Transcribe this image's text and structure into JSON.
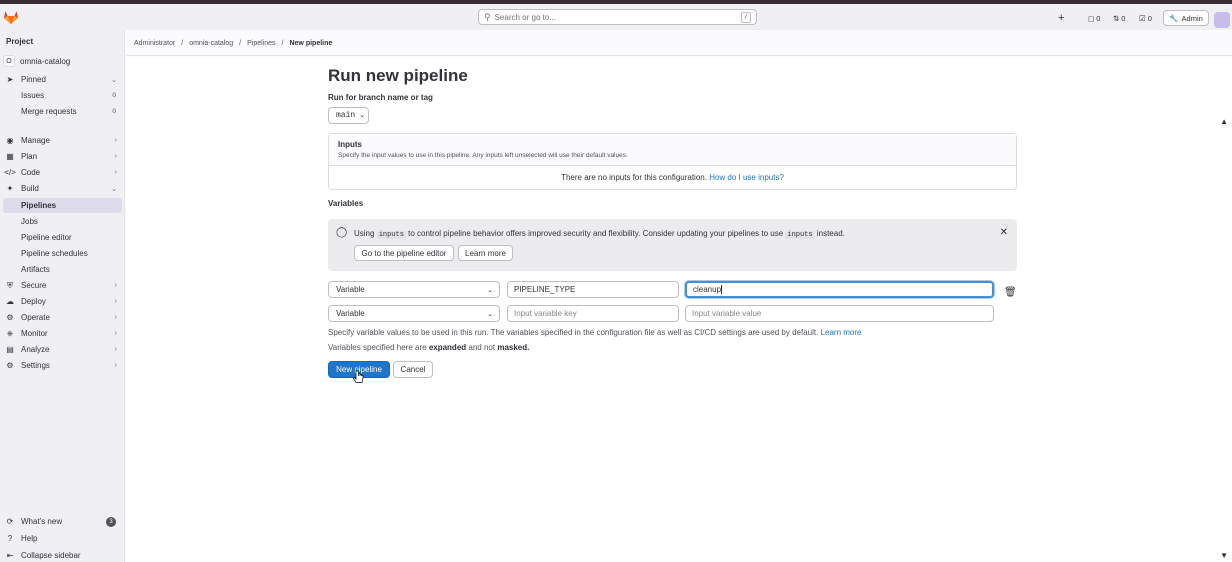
{
  "topbar": {
    "search_placeholder": "Search or go to...",
    "search_shortcut": "/",
    "issues_count": "0",
    "mr_count": "0",
    "todo_count": "0",
    "admin_label": "Admin"
  },
  "sidebar": {
    "heading": "Project",
    "project_initial": "O",
    "project_name": "omnia-catalog",
    "pinned": "Pinned",
    "issues": "Issues",
    "issues_count": "0",
    "merge_requests": "Merge requests",
    "mr_count": "0",
    "manage": "Manage",
    "plan": "Plan",
    "code": "Code",
    "build": "Build",
    "pipelines": "Pipelines",
    "jobs": "Jobs",
    "pipeline_editor": "Pipeline editor",
    "pipeline_schedules": "Pipeline schedules",
    "artifacts": "Artifacts",
    "secure": "Secure",
    "deploy": "Deploy",
    "operate": "Operate",
    "monitor": "Monitor",
    "analyze": "Analyze",
    "settings": "Settings",
    "whats_new": "What's new",
    "whats_new_count": "3",
    "help": "Help",
    "collapse": "Collapse sidebar"
  },
  "breadcrumb": [
    "Administrator",
    "omnia-catalog",
    "Pipelines",
    "New pipeline"
  ],
  "breadcrumb_sep": "/",
  "page": {
    "title": "Run new pipeline",
    "branch_label": "Run for branch name or tag",
    "branch_value": "main",
    "inputs_title": "Inputs",
    "inputs_desc": "Specify the input values to use in this pipeline. Any inputs left unselected will use their default values.",
    "inputs_empty": "There are no inputs for this configuration.",
    "inputs_link": "How do I use inputs?",
    "variables_heading": "Variables",
    "alert_part1": "Using",
    "alert_code1": "inputs",
    "alert_part2": "to control pipeline behavior offers improved security and flexibility. Consider updating your pipelines to use",
    "alert_code2": "inputs",
    "alert_part3": "instead.",
    "alert_btn_editor": "Go to the pipeline editor",
    "alert_btn_learn": "Learn more",
    "var_type_1": "Variable",
    "var_key_1": "PIPELINE_TYPE",
    "var_value_1": "cleanup",
    "var_type_2": "Variable",
    "var_key_placeholder": "Input variable key",
    "var_value_placeholder": "Input variable value",
    "help_text": "Specify variable values to be used in this run. The variables specified in the configuration file as well as CI/CD settings are used by default.",
    "help_link": "Learn more",
    "help2_a": "Variables specified here are",
    "help2_b": "expanded",
    "help2_c": "and not",
    "help2_d": "masked.",
    "submit": "New pipeline",
    "cancel": "Cancel"
  }
}
